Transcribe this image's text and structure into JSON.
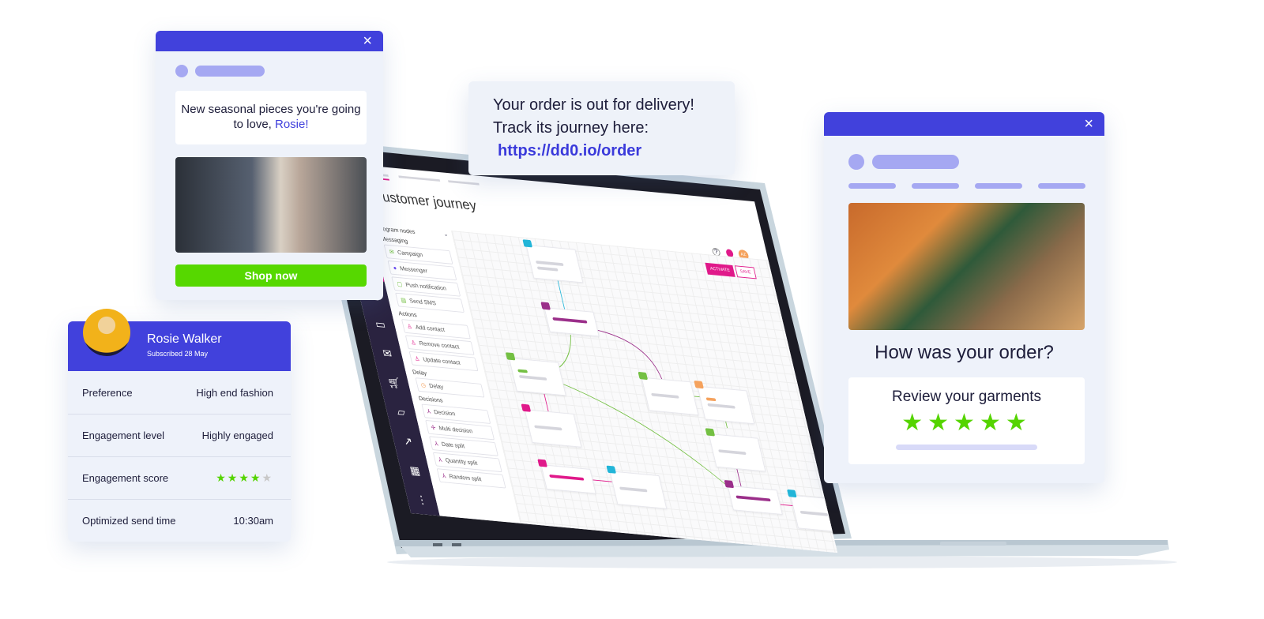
{
  "promo_popup": {
    "body_text": "New seasonal pieces you're going to love, ",
    "name": "Rosie!",
    "button": "Shop now",
    "close_icon": "close-icon"
  },
  "sms": {
    "line1": "Your order is out for delivery!",
    "line2": "Track its journey here:",
    "link": "https://dd0.io/order"
  },
  "review_popup": {
    "title": "How was your order?",
    "subtitle": "Review your garments",
    "stars": 5,
    "close_icon": "close-icon"
  },
  "profile": {
    "name": "Rosie Walker",
    "subscribed": "Subscribed 28 May",
    "rows": [
      {
        "label": "Preference",
        "value": "High end fashion"
      },
      {
        "label": "Engagement level",
        "value": "Highly engaged"
      },
      {
        "label": "Engagement score",
        "value": "",
        "stars": 4,
        "max_stars": 5
      },
      {
        "label": "Optimized send time",
        "value": "10:30am"
      }
    ]
  },
  "app": {
    "title": "Customer journey",
    "activate": "ACTIVATE",
    "save": "SAVE",
    "avatar_initials": "AZ",
    "panel_title": "Program nodes",
    "sections": [
      {
        "label": "Messaging",
        "items": [
          "Campaign",
          "Messenger",
          "Push notification",
          "Send SMS"
        ]
      },
      {
        "label": "Actions",
        "items": [
          "Add contact",
          "Remove contact",
          "Update contact"
        ]
      },
      {
        "label": "Delay",
        "items": [
          "Delay"
        ]
      },
      {
        "label": "Decisions",
        "items": [
          "Decision",
          "Multi decision",
          "Date split",
          "Quantity split",
          "Random split"
        ]
      }
    ]
  },
  "colors": {
    "brand": "#4141dc",
    "green": "#55d400",
    "pink": "#e0198a",
    "sidebar": "#2a2340"
  }
}
